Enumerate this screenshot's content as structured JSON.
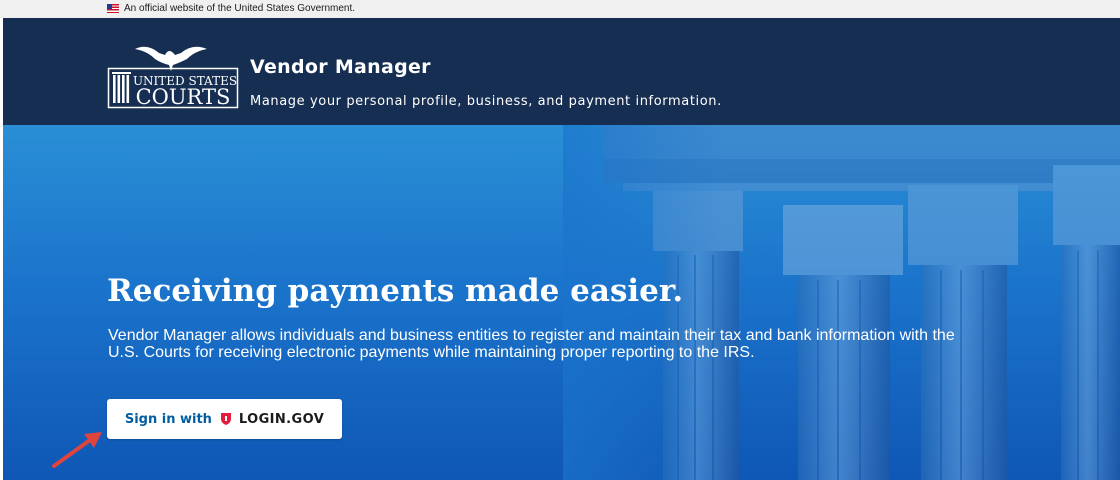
{
  "gov_banner": {
    "text": "An official website of the United States Government."
  },
  "header": {
    "logo_alt": "United States Courts",
    "logo_line1": "UNITED STATES",
    "logo_line2": "COURTS",
    "title": "Vendor Manager",
    "subtitle": "Manage your personal profile, business, and payment information."
  },
  "hero": {
    "headline": "Receiving payments made easier.",
    "description": "Vendor Manager allows individuals and business entities to register and maintain their tax and bank information with the U.S. Courts for receiving electronic payments while maintaining proper reporting to the IRS.",
    "signin": {
      "prefix": "Sign in with",
      "brand": "LOGIN.GOV",
      "brand_icon": "login-gov-shield-icon"
    }
  },
  "colors": {
    "header_bg": "#162e51",
    "hero_top": "#2a8fd6",
    "hero_bottom": "#0f57b5",
    "button_text": "#005ea2",
    "login_gov_red": "#e21c3d",
    "annotation_arrow": "#e0443e"
  }
}
